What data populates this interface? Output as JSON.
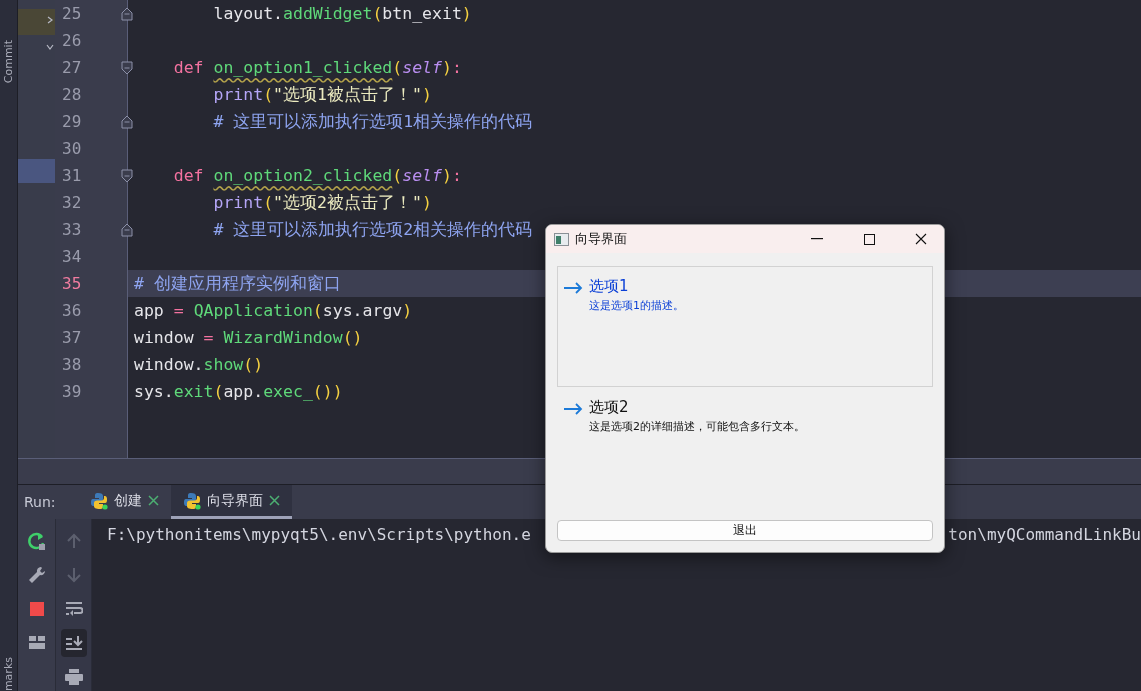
{
  "side_strip": {
    "labels": [
      "Commit",
      "marks"
    ]
  },
  "editor": {
    "lines": [
      {
        "number": "25",
        "current": false,
        "fold_start": false,
        "fold_end": true,
        "segments": [
          {
            "kind": "plain",
            "text": "        layout."
          },
          {
            "kind": "call",
            "text": "addWidget"
          },
          {
            "kind": "paren",
            "text": "("
          },
          {
            "kind": "plain",
            "text": "btn_exit"
          },
          {
            "kind": "paren",
            "text": ")"
          }
        ]
      },
      {
        "number": "26",
        "current": false,
        "fold_start": false,
        "fold_end": false
      },
      {
        "number": "27",
        "current": false,
        "fold_start": true,
        "fold_end": false,
        "segments": [
          {
            "kind": "keyword",
            "text": "    def "
          },
          {
            "kind": "func",
            "text": "on_option1_clicked"
          },
          {
            "kind": "paren",
            "text": "("
          },
          {
            "kind": "self",
            "text": "self"
          },
          {
            "kind": "paren",
            "text": ")"
          },
          {
            "kind": "op",
            "text": ":"
          }
        ]
      },
      {
        "number": "28",
        "current": false,
        "fold_start": false,
        "fold_end": false,
        "segments": [
          {
            "kind": "builtin",
            "text": "        print"
          },
          {
            "kind": "paren",
            "text": "("
          },
          {
            "kind": "string",
            "text": "\"选项1被点击了！\""
          },
          {
            "kind": "paren",
            "text": ")"
          }
        ]
      },
      {
        "number": "29",
        "current": false,
        "fold_start": false,
        "fold_end": true,
        "segments": [
          {
            "kind": "comment",
            "text": "        # 这里可以添加执行选项1相关操作的代码"
          }
        ]
      },
      {
        "number": "30",
        "current": false,
        "fold_start": false,
        "fold_end": false
      },
      {
        "number": "31",
        "current": false,
        "fold_start": true,
        "fold_end": false,
        "segments": [
          {
            "kind": "keyword",
            "text": "    def "
          },
          {
            "kind": "func",
            "text": "on_option2_clicked"
          },
          {
            "kind": "paren",
            "text": "("
          },
          {
            "kind": "self",
            "text": "self"
          },
          {
            "kind": "paren",
            "text": ")"
          },
          {
            "kind": "op",
            "text": ":"
          }
        ]
      },
      {
        "number": "32",
        "current": false,
        "fold_start": false,
        "fold_end": false,
        "segments": [
          {
            "kind": "builtin",
            "text": "        print"
          },
          {
            "kind": "paren",
            "text": "("
          },
          {
            "kind": "string",
            "text": "\"选项2被点击了！\""
          },
          {
            "kind": "paren",
            "text": ")"
          }
        ]
      },
      {
        "number": "33",
        "current": false,
        "fold_start": false,
        "fold_end": true,
        "segments": [
          {
            "kind": "comment",
            "text": "        # 这里可以添加执行选项2相关操作的代码"
          }
        ]
      },
      {
        "number": "34",
        "current": false,
        "fold_start": false,
        "fold_end": false
      },
      {
        "number": "35",
        "current": true,
        "fold_start": false,
        "fold_end": false,
        "segments": [
          {
            "kind": "comment",
            "text": "# 创建应用程序实例和窗口"
          }
        ]
      },
      {
        "number": "36",
        "current": false,
        "fold_start": false,
        "fold_end": false,
        "segments": [
          {
            "kind": "plain",
            "text": "app "
          },
          {
            "kind": "op",
            "text": "= "
          },
          {
            "kind": "call",
            "text": "QApplication"
          },
          {
            "kind": "paren",
            "text": "("
          },
          {
            "kind": "plain",
            "text": "sys.argv"
          },
          {
            "kind": "paren",
            "text": ")"
          }
        ]
      },
      {
        "number": "37",
        "current": false,
        "fold_start": false,
        "fold_end": false,
        "segments": [
          {
            "kind": "plain",
            "text": "window "
          },
          {
            "kind": "op",
            "text": "= "
          },
          {
            "kind": "call",
            "text": "WizardWindow"
          },
          {
            "kind": "paren",
            "text": "()"
          }
        ]
      },
      {
        "number": "38",
        "current": false,
        "fold_start": false,
        "fold_end": false,
        "segments": [
          {
            "kind": "plain",
            "text": "window."
          },
          {
            "kind": "call",
            "text": "show"
          },
          {
            "kind": "paren",
            "text": "()"
          }
        ]
      },
      {
        "number": "39",
        "current": false,
        "fold_start": false,
        "fold_end": false,
        "segments": [
          {
            "kind": "plain",
            "text": "sys."
          },
          {
            "kind": "call",
            "text": "exit"
          },
          {
            "kind": "paren",
            "text": "("
          },
          {
            "kind": "plain",
            "text": "app."
          },
          {
            "kind": "call",
            "text": "exec_"
          },
          {
            "kind": "paren",
            "text": "())"
          }
        ]
      }
    ]
  },
  "run_panel": {
    "label": "Run:",
    "tabs": [
      {
        "label": "创建",
        "selected": false
      },
      {
        "label": "向导界面",
        "selected": true
      }
    ],
    "run_tools": [
      {
        "kind": "rerun"
      },
      {
        "kind": "wrench"
      },
      {
        "kind": "stop"
      },
      {
        "kind": "layout"
      }
    ],
    "output_tools": [
      {
        "kind": "up",
        "disabled": true,
        "selected": false
      },
      {
        "kind": "down",
        "disabled": true,
        "selected": false
      },
      {
        "kind": "wrap",
        "disabled": false,
        "selected": false
      },
      {
        "kind": "scroll_end",
        "disabled": false,
        "selected": true
      },
      {
        "kind": "print",
        "disabled": false,
        "selected": false
      }
    ],
    "console_parts": [
      "F:\\pythonitems\\mypyqt5\\.env\\Scripts\\python.e",
      "ton\\myQCommandLinkBu"
    ]
  },
  "dialog": {
    "title": "向导界面",
    "options": [
      {
        "title": "选项1",
        "description": "这是选项1的描述。",
        "focused": true
      },
      {
        "title": "选项2",
        "description": "这是选项2的详细描述，可能包含多行文本。",
        "focused": false
      }
    ],
    "exit_button": "退出"
  }
}
